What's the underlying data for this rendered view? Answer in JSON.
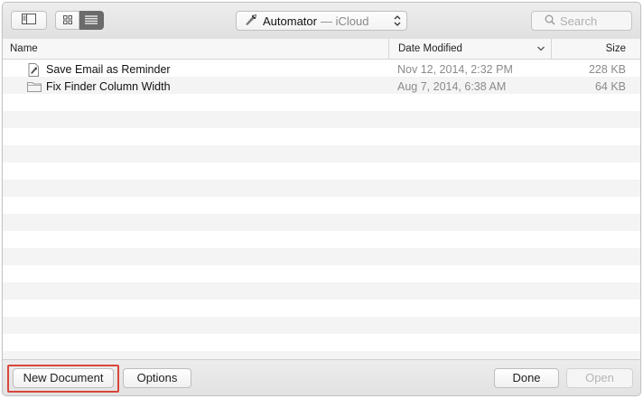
{
  "toolbar": {
    "location": {
      "name": "Automator",
      "separator": "— iCloud",
      "icon": "automator-robot-icon"
    },
    "search": {
      "placeholder": "Search"
    },
    "view_modes": [
      "icon-view",
      "list-view"
    ],
    "selected_view": "list-view"
  },
  "columns": {
    "name": "Name",
    "date": "Date Modified",
    "size": "Size",
    "sorted_by": "date"
  },
  "files": [
    {
      "name": "Save Email as Reminder",
      "date": "Nov 12, 2014, 2:32 PM",
      "size": "228 KB",
      "icon": "workflow-document-icon"
    },
    {
      "name": "Fix Finder Column Width",
      "date": "Aug 7, 2014, 6:38 AM",
      "size": "64 KB",
      "icon": "folder-icon"
    }
  ],
  "footer": {
    "new_document": "New Document",
    "options": "Options",
    "done": "Done",
    "open": "Open"
  },
  "colors": {
    "highlight": "#d9463c",
    "selected_segment": "#6b6b6b"
  }
}
